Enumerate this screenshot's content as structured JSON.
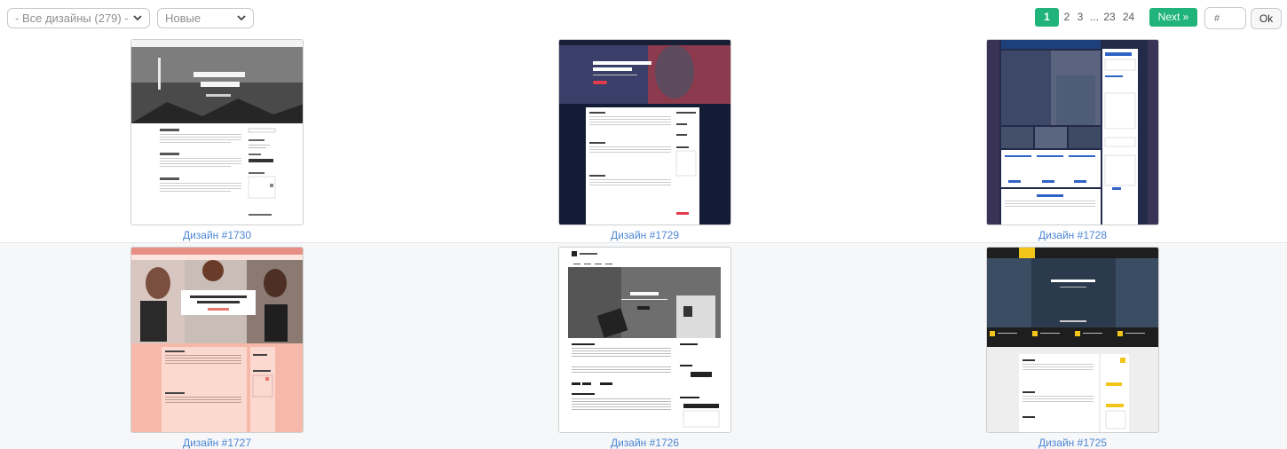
{
  "toolbar": {
    "designs_filter": "- Все дизайны (279) -",
    "sort_filter": "Новые",
    "pagination": [
      "1",
      "2",
      "3",
      "...",
      "23",
      "24"
    ],
    "next_label": "Next »",
    "page_input_placeholder": "#",
    "ok_label": "Ok"
  },
  "designs": [
    {
      "caption": "Дизайн #1730",
      "hero": "Save your best moments now"
    },
    {
      "caption": "Дизайн #1729",
      "hero": "LOREM IPSUM DOLOR SIT AMET CONSECTETUR"
    },
    {
      "caption": "Дизайн #1728",
      "hero": "LOREM IPSUM"
    },
    {
      "caption": "Дизайн #1727",
      "hero": "LOREM IPSUM DOLOR SIT AMET, CONSECTETUR"
    },
    {
      "caption": "Дизайн #1726",
      "hero": "LOREM IPSUM"
    },
    {
      "caption": "Дизайн #1725",
      "hero": "LOREM IPSUM"
    }
  ],
  "colors": {
    "accent": "#20b37a",
    "link": "#4c86d4",
    "border": "#c9c9c9"
  }
}
